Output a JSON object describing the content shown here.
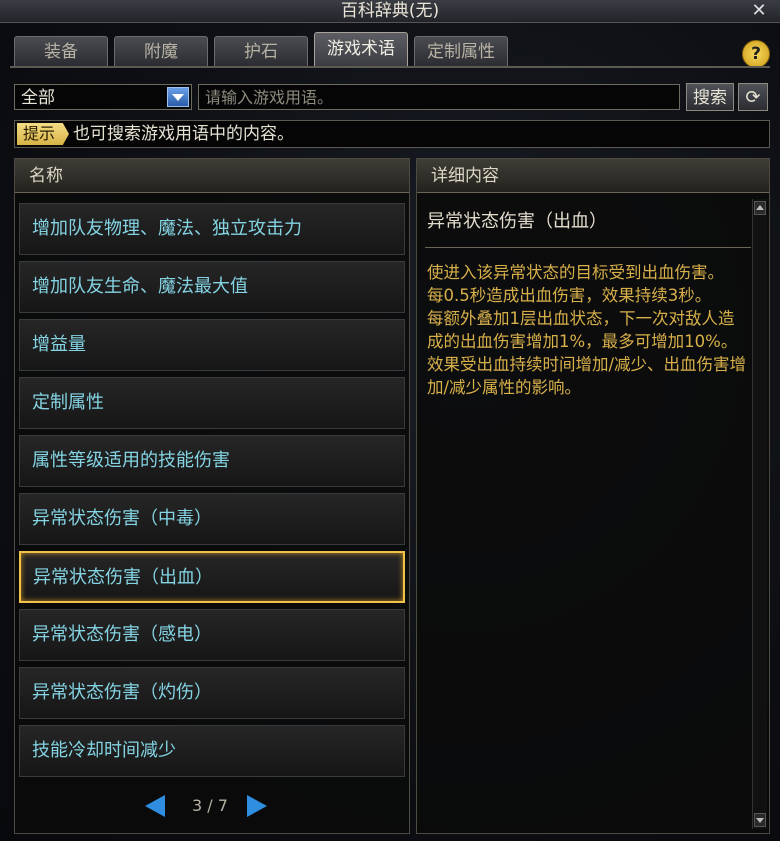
{
  "window": {
    "title": "百科辞典(无)",
    "close_icon": "✕"
  },
  "tabs": [
    {
      "label": "装备"
    },
    {
      "label": "附魔"
    },
    {
      "label": "护石"
    },
    {
      "label": "游戏术语",
      "active": true
    },
    {
      "label": "定制属性"
    }
  ],
  "help": {
    "icon": "?"
  },
  "search": {
    "category": "全部",
    "placeholder": "请输入游戏用语。",
    "button_label": "搜索",
    "refresh_icon": "⟳"
  },
  "hint": {
    "tag": "提示",
    "text": "也可搜索游戏用语中的内容。"
  },
  "list": {
    "header": "名称",
    "items": [
      "增加队友物理、魔法、独立攻击力",
      "增加队友生命、魔法最大值",
      "增益量",
      "定制属性",
      "属性等级适用的技能伤害",
      "异常状态伤害（中毒）",
      "异常状态伤害（出血）",
      "异常状态伤害（感电）",
      "异常状态伤害（灼伤）",
      "技能冷却时间减少"
    ],
    "selected_index": 6,
    "page": "3 / 7"
  },
  "detail": {
    "header": "详细内容",
    "title": "异常状态伤害（出血）",
    "body": "使进入该异常状态的目标受到出血伤害。\n每0.5秒造成出血伤害，效果持续3秒。\n每额外叠加1层出血状态，下一次对敌人造成的出血伤害增加1%，最多可增加10%。\n效果受出血持续时间增加/减少、出血伤害增加/减少属性的影响。"
  },
  "colors": {
    "list_text": "#84d4e4",
    "detail_text": "#d8b04a",
    "selected_border": "#f0c24a"
  }
}
